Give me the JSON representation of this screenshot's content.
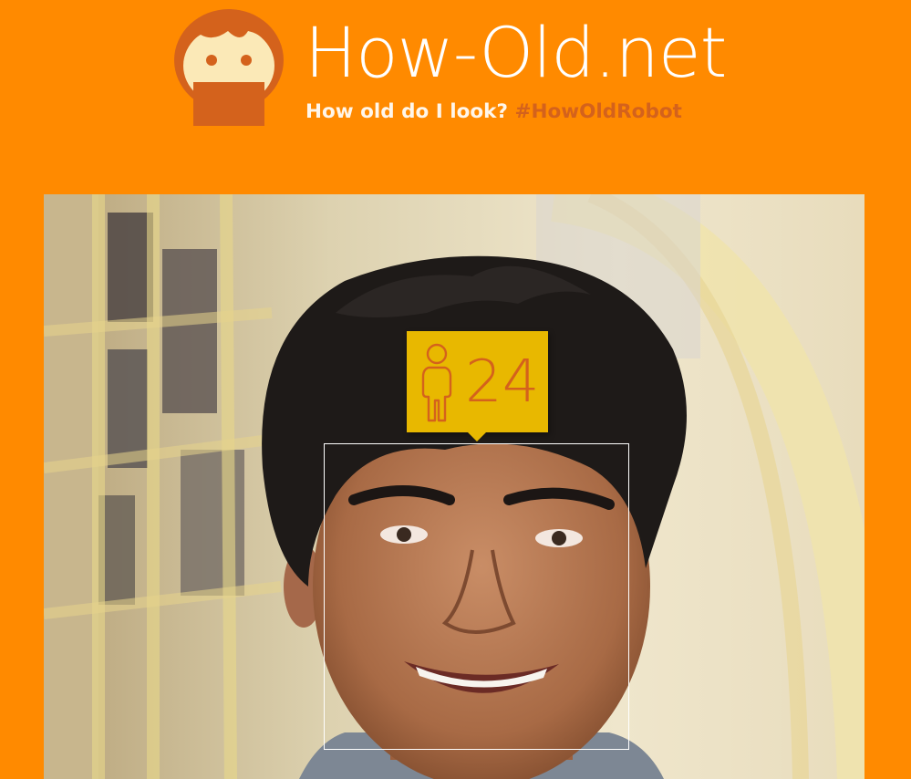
{
  "header": {
    "site_title": "How-Old.net",
    "tagline_question": "How old do I look?",
    "tagline_hashtag": "#HowOldRobot"
  },
  "result": {
    "age": "24",
    "gender_icon": "male-figure-icon"
  },
  "colors": {
    "background": "#ff8a00",
    "badge": "#e8b800",
    "accent": "#d4621c",
    "face_box": "#ffffff"
  }
}
